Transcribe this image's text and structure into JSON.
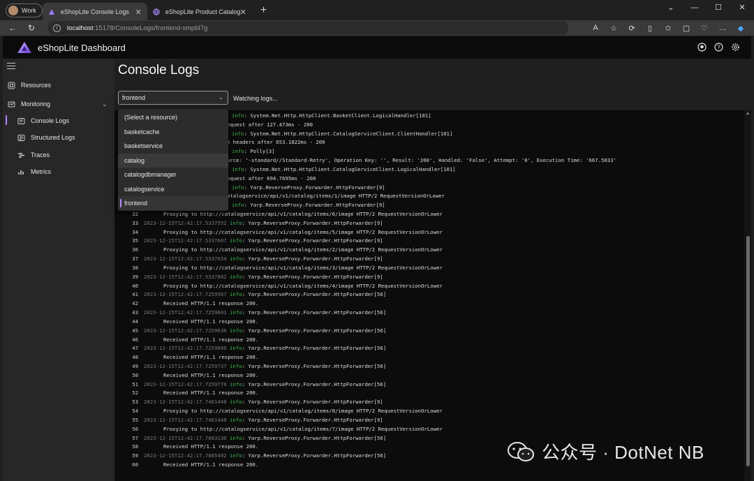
{
  "browser": {
    "profile_label": "Work",
    "tabs": [
      {
        "title": "eShopLite Console Logs"
      },
      {
        "title": "eShopLite Product Catalog"
      }
    ],
    "url_host": "localhost",
    "url_path": ":15178/ConsoleLogs/frontend-smpbl7g"
  },
  "app": {
    "title": "eShopLite Dashboard"
  },
  "sidebar": {
    "resources": "Resources",
    "monitoring": "Monitoring",
    "sub": [
      "Console Logs",
      "Structured Logs",
      "Traces",
      "Metrics"
    ]
  },
  "main": {
    "title": "Console Logs",
    "selected_resource": "frontend",
    "status": "Watching logs..."
  },
  "dropdown": {
    "options": [
      "(Select a resource)",
      "basketcache",
      "basketservice",
      "catalog",
      "catalogdbmanager",
      "catalogservice",
      "frontend"
    ],
    "hovered": "catalog",
    "selected": "frontend"
  },
  "logs": [
    {
      "n": "",
      "ts": "",
      "lvl": "info",
      "msg": ": System.Net.Http.HttpClient.BasketClient.LogicalHandler[101]"
    },
    {
      "n": "",
      "ts": "",
      "lvl": "",
      "msg": "equest after 127.473ms - 200"
    },
    {
      "n": "",
      "ts": "",
      "lvl": "info",
      "msg": ": System.Net.Http.HttpClient.CatalogServiceClient.ClientHandler[101]"
    },
    {
      "n": "",
      "ts": "",
      "lvl": "",
      "msg": "e headers after 653.1822ms - 200"
    },
    {
      "n": "",
      "ts": "",
      "lvl": "info",
      "msg": ": Polly[3]"
    },
    {
      "n": "",
      "ts": "",
      "lvl": "",
      "msg": "urce: '-standard//Standard-Retry', Operation Key: '', Result: '200', Handled: 'False', Attempt: '0', Execution Time: '667.5033'"
    },
    {
      "n": "",
      "ts": "",
      "lvl": "info",
      "msg": ": System.Net.Http.HttpClient.CatalogServiceClient.LogicalHandler[101]"
    },
    {
      "n": "",
      "ts": "",
      "lvl": "",
      "msg": "equest after 694.7695ms - 200"
    },
    {
      "n": "",
      "ts": "",
      "lvl": "info",
      "msg": ": Yarp.ReverseProxy.Forwarder.HttpForwarder[9]"
    },
    {
      "n": "",
      "ts": "",
      "lvl": "",
      "msg": "atalogservice/api/v1/catalog/items/1/image HTTP/2 RequestVersionOrLower"
    },
    {
      "n": "",
      "ts": "",
      "lvl": "info",
      "msg": ": Yarp.ReverseProxy.Forwarder.HttpForwarder[9]"
    },
    {
      "n": "32",
      "ts": "",
      "lvl": "",
      "msg": "Proxying to http://catalogservice/api/v1/catalog/items/6/image HTTP/2 RequestVersionOrLower"
    },
    {
      "n": "33",
      "ts": "2023-12-15T12:42:17.5337552",
      "lvl": "info",
      "msg": ": Yarp.ReverseProxy.Forwarder.HttpForwarder[9]"
    },
    {
      "n": "34",
      "ts": "",
      "lvl": "",
      "msg": "Proxying to http://catalogservice/api/v1/catalog/items/5/image HTTP/2 RequestVersionOrLower"
    },
    {
      "n": "35",
      "ts": "2023-12-15T12:42:17.5337607",
      "lvl": "info",
      "msg": ": Yarp.ReverseProxy.Forwarder.HttpForwarder[9]"
    },
    {
      "n": "36",
      "ts": "",
      "lvl": "",
      "msg": "Proxying to http://catalogservice/api/v1/catalog/items/2/image HTTP/2 RequestVersionOrLower"
    },
    {
      "n": "37",
      "ts": "2023-12-15T12:42:17.5337654",
      "lvl": "info",
      "msg": ": Yarp.ReverseProxy.Forwarder.HttpForwarder[9]"
    },
    {
      "n": "38",
      "ts": "",
      "lvl": "",
      "msg": "Proxying to http://catalogservice/api/v1/catalog/items/3/image HTTP/2 RequestVersionOrLower"
    },
    {
      "n": "39",
      "ts": "2023-12-15T12:42:17.5337802",
      "lvl": "info",
      "msg": ": Yarp.ReverseProxy.Forwarder.HttpForwarder[9]"
    },
    {
      "n": "40",
      "ts": "",
      "lvl": "",
      "msg": "Proxying to http://catalogservice/api/v1/catalog/items/4/image HTTP/2 RequestVersionOrLower"
    },
    {
      "n": "41",
      "ts": "2023-12-15T12:42:17.7259567",
      "lvl": "info",
      "msg": ": Yarp.ReverseProxy.Forwarder.HttpForwarder[56]"
    },
    {
      "n": "42",
      "ts": "",
      "lvl": "",
      "msg": "Received HTTP/1.1 response 200."
    },
    {
      "n": "43",
      "ts": "2023-12-15T12:42:17.7259601",
      "lvl": "info",
      "msg": ": Yarp.ReverseProxy.Forwarder.HttpForwarder[56]"
    },
    {
      "n": "44",
      "ts": "",
      "lvl": "",
      "msg": "Received HTTP/1.1 response 200."
    },
    {
      "n": "45",
      "ts": "2023-12-15T12:42:17.7259636",
      "lvl": "info",
      "msg": ": Yarp.ReverseProxy.Forwarder.HttpForwarder[56]"
    },
    {
      "n": "46",
      "ts": "",
      "lvl": "",
      "msg": "Received HTTP/1.1 response 200."
    },
    {
      "n": "47",
      "ts": "2023-12-15T12:42:17.7259686",
      "lvl": "info",
      "msg": ": Yarp.ReverseProxy.Forwarder.HttpForwarder[56]"
    },
    {
      "n": "48",
      "ts": "",
      "lvl": "",
      "msg": "Received HTTP/1.1 response 200."
    },
    {
      "n": "49",
      "ts": "2023-12-15T12:42:17.7259737",
      "lvl": "info",
      "msg": ": Yarp.ReverseProxy.Forwarder.HttpForwarder[56]"
    },
    {
      "n": "50",
      "ts": "",
      "lvl": "",
      "msg": "Received HTTP/1.1 response 200."
    },
    {
      "n": "51",
      "ts": "2023-12-15T12:42:17.7259770",
      "lvl": "info",
      "msg": ": Yarp.ReverseProxy.Forwarder.HttpForwarder[56]"
    },
    {
      "n": "52",
      "ts": "",
      "lvl": "",
      "msg": "Received HTTP/1.1 response 200."
    },
    {
      "n": "53",
      "ts": "2023-12-15T12:42:17.7461448",
      "lvl": "info",
      "msg": ": Yarp.ReverseProxy.Forwarder.HttpForwarder[9]"
    },
    {
      "n": "54",
      "ts": "",
      "lvl": "",
      "msg": "Proxying to http://catalogservice/api/v1/catalog/items/8/image HTTP/2 RequestVersionOrLower"
    },
    {
      "n": "55",
      "ts": "2023-12-15T12:42:17.7461448",
      "lvl": "info",
      "msg": ": Yarp.ReverseProxy.Forwarder.HttpForwarder[9]"
    },
    {
      "n": "56",
      "ts": "",
      "lvl": "",
      "msg": "Proxying to http://catalogservice/api/v1/catalog/items/7/image HTTP/2 RequestVersionOrLower"
    },
    {
      "n": "57",
      "ts": "2023-12-15T12:42:17.7883136",
      "lvl": "info",
      "msg": ": Yarp.ReverseProxy.Forwarder.HttpForwarder[56]"
    },
    {
      "n": "58",
      "ts": "",
      "lvl": "",
      "msg": "Received HTTP/1.1 response 200."
    },
    {
      "n": "59",
      "ts": "2023-12-15T12:42:17.7885492",
      "lvl": "info",
      "msg": ": Yarp.ReverseProxy.Forwarder.HttpForwarder[56]"
    },
    {
      "n": "60",
      "ts": "",
      "lvl": "",
      "msg": "Received HTTP/1.1 response 200."
    }
  ],
  "watermark": {
    "text": "公众号 · DotNet NB"
  },
  "colors": {
    "accent": "#b38bff",
    "info": "#3fb950",
    "header_bg": "#0b0b0b"
  },
  "icons": [
    "github-icon",
    "help-icon",
    "settings-icon",
    "resources-icon",
    "monitoring-icon",
    "console-logs-icon",
    "structured-logs-icon",
    "traces-icon",
    "metrics-icon"
  ]
}
